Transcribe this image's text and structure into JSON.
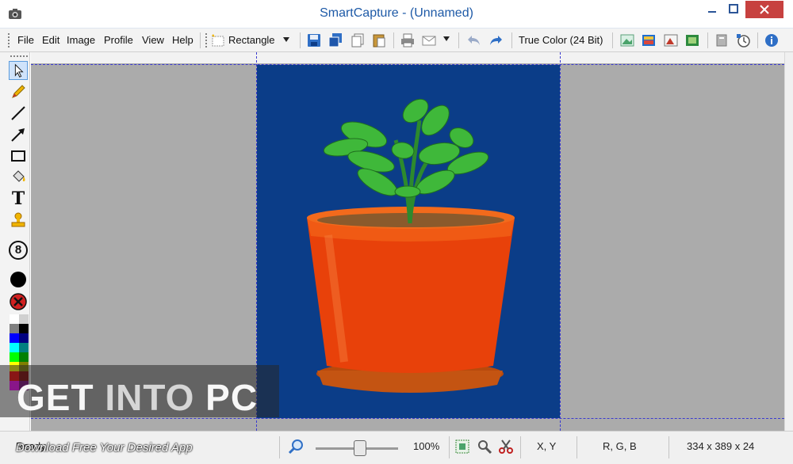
{
  "window": {
    "title": "SmartCapture - (Unnamed)",
    "app_icon": "camera-icon",
    "controls": {
      "minimize_icon": "minimize-icon",
      "maximize_icon": "maximize-icon",
      "close_icon": "close-icon"
    }
  },
  "menu": {
    "items": [
      "File",
      "Edit",
      "Image",
      "Profile",
      "View",
      "Help"
    ]
  },
  "toolbar": {
    "shape_select": {
      "label": "Rectangle",
      "icon": "rectangle-select-icon"
    },
    "color_mode": "True Color (24 Bit)",
    "icons": [
      "save-icon",
      "save-all-icon",
      "copy-icon",
      "paste-icon",
      "print-icon",
      "email-icon",
      "undo-icon",
      "redo-icon",
      "image-icon-1",
      "image-icon-2",
      "image-icon-3",
      "image-icon-4",
      "settings-icon",
      "timer-icon",
      "info-icon"
    ]
  },
  "tools": [
    "select-arrow-icon",
    "pencil-icon",
    "line-icon",
    "arrow-icon",
    "rectangle-icon",
    "fill-bucket-icon",
    "text-icon",
    "stamp-icon",
    "number-stamp-icon",
    "brush-size-icon",
    "delete-icon"
  ],
  "tools_labels": {
    "text_tool": "T",
    "number_tool": "8"
  },
  "palette": [
    "#ffffff",
    "#d0d0d0",
    "#808080",
    "#000000",
    "#0000ff",
    "#000080",
    "#00ffff",
    "#008080",
    "#00ff00",
    "#008000",
    "#ffff00",
    "#808000",
    "#ff0000",
    "#800000",
    "#ff00ff",
    "#800080"
  ],
  "canvas": {
    "background": "#ababab",
    "image_background": "#0b3d88",
    "image_subject": "potted plant"
  },
  "status": {
    "ready": "Ready",
    "zoom": "100%",
    "zoom_level": 0.5,
    "coordinates": "X, Y",
    "rgb": "R, G, B",
    "dimensions": "334 x 389 x 24"
  },
  "watermark": {
    "part1": "GET ",
    "part2": "INTO",
    "part3": " PC",
    "subtitle": "Download Free Your Desired App"
  }
}
